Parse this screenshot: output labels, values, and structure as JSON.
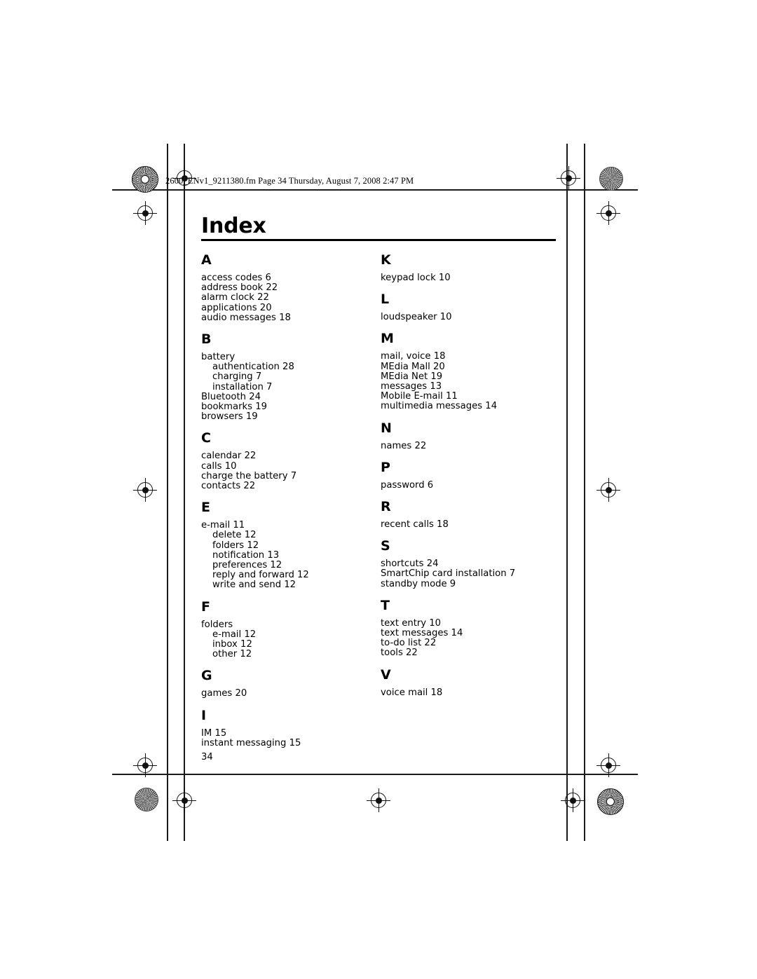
{
  "document": {
    "header_line": "2600_ENv1_9211380.fm  Page 34  Thursday, August 7, 2008  2:47 PM",
    "title": "Index",
    "folio": "34"
  },
  "index": {
    "left_column": [
      {
        "letter": "A",
        "entries": [
          {
            "text": "access codes 6",
            "sub": false
          },
          {
            "text": "address book 22",
            "sub": false
          },
          {
            "text": "alarm clock 22",
            "sub": false
          },
          {
            "text": "applications 20",
            "sub": false
          },
          {
            "text": "audio messages 18",
            "sub": false
          }
        ]
      },
      {
        "letter": "B",
        "entries": [
          {
            "text": "battery",
            "sub": false
          },
          {
            "text": "authentication 28",
            "sub": true
          },
          {
            "text": "charging 7",
            "sub": true
          },
          {
            "text": "installation 7",
            "sub": true
          },
          {
            "text": "Bluetooth 24",
            "sub": false
          },
          {
            "text": "bookmarks 19",
            "sub": false
          },
          {
            "text": "browsers 19",
            "sub": false
          }
        ]
      },
      {
        "letter": "C",
        "entries": [
          {
            "text": "calendar 22",
            "sub": false
          },
          {
            "text": "calls 10",
            "sub": false
          },
          {
            "text": "charge the battery 7",
            "sub": false
          },
          {
            "text": "contacts 22",
            "sub": false
          }
        ]
      },
      {
        "letter": "E",
        "entries": [
          {
            "text": "e-mail 11",
            "sub": false
          },
          {
            "text": "delete 12",
            "sub": true
          },
          {
            "text": "folders 12",
            "sub": true
          },
          {
            "text": "notification 13",
            "sub": true
          },
          {
            "text": "preferences 12",
            "sub": true
          },
          {
            "text": "reply and forward 12",
            "sub": true
          },
          {
            "text": "write and send 12",
            "sub": true
          }
        ]
      },
      {
        "letter": "F",
        "entries": [
          {
            "text": "folders",
            "sub": false
          },
          {
            "text": "e-mail 12",
            "sub": true
          },
          {
            "text": "inbox 12",
            "sub": true
          },
          {
            "text": "other 12",
            "sub": true
          }
        ]
      },
      {
        "letter": "G",
        "entries": [
          {
            "text": "games 20",
            "sub": false
          }
        ]
      },
      {
        "letter": "I",
        "entries": [
          {
            "text": "IM 15",
            "sub": false
          },
          {
            "text": "instant messaging 15",
            "sub": false
          }
        ]
      }
    ],
    "right_column": [
      {
        "letter": "K",
        "entries": [
          {
            "text": "keypad lock 10",
            "sub": false
          }
        ]
      },
      {
        "letter": "L",
        "entries": [
          {
            "text": "loudspeaker 10",
            "sub": false
          }
        ]
      },
      {
        "letter": "M",
        "entries": [
          {
            "text": "mail, voice 18",
            "sub": false
          },
          {
            "text": "MEdia Mall 20",
            "sub": false
          },
          {
            "text": "MEdia Net 19",
            "sub": false
          },
          {
            "text": "messages 13",
            "sub": false
          },
          {
            "text": "Mobile E-mail 11",
            "sub": false
          },
          {
            "text": "multimedia messages 14",
            "sub": false
          }
        ]
      },
      {
        "letter": "N",
        "entries": [
          {
            "text": "names 22",
            "sub": false
          }
        ]
      },
      {
        "letter": "P",
        "entries": [
          {
            "text": "password 6",
            "sub": false
          }
        ]
      },
      {
        "letter": "R",
        "entries": [
          {
            "text": "recent calls 18",
            "sub": false
          }
        ]
      },
      {
        "letter": "S",
        "entries": [
          {
            "text": "shortcuts 24",
            "sub": false
          },
          {
            "text": "SmartChip card installation 7",
            "sub": false
          },
          {
            "text": "standby mode 9",
            "sub": false
          }
        ]
      },
      {
        "letter": "T",
        "entries": [
          {
            "text": "text entry 10",
            "sub": false
          },
          {
            "text": "text messages 14",
            "sub": false
          },
          {
            "text": "to-do list 22",
            "sub": false
          },
          {
            "text": "tools 22",
            "sub": false
          }
        ]
      },
      {
        "letter": "V",
        "entries": [
          {
            "text": "voice mail 18",
            "sub": false
          }
        ]
      }
    ]
  }
}
